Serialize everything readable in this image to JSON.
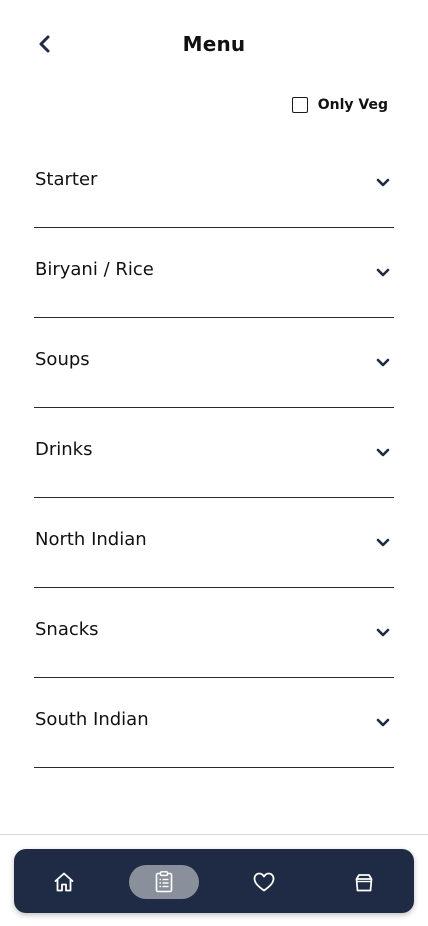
{
  "header": {
    "title": "Menu",
    "back_icon": "chevron-left-icon"
  },
  "filter": {
    "label": "Only Veg",
    "checked": false
  },
  "categories": [
    {
      "label": "Starter"
    },
    {
      "label": "Biryani / Rice"
    },
    {
      "label": "Soups"
    },
    {
      "label": "Drinks"
    },
    {
      "label": "North Indian"
    },
    {
      "label": "Snacks"
    },
    {
      "label": "South Indian"
    }
  ],
  "tab_bar": {
    "tabs": [
      {
        "icon": "home-icon",
        "active": false
      },
      {
        "icon": "clipboard-icon",
        "active": true
      },
      {
        "icon": "heart-icon",
        "active": false
      },
      {
        "icon": "bag-icon",
        "active": false
      }
    ]
  },
  "colors": {
    "accent": "#1f2b44",
    "tab_active_bg": "#8a909b",
    "divider": "#2a2a2a"
  }
}
